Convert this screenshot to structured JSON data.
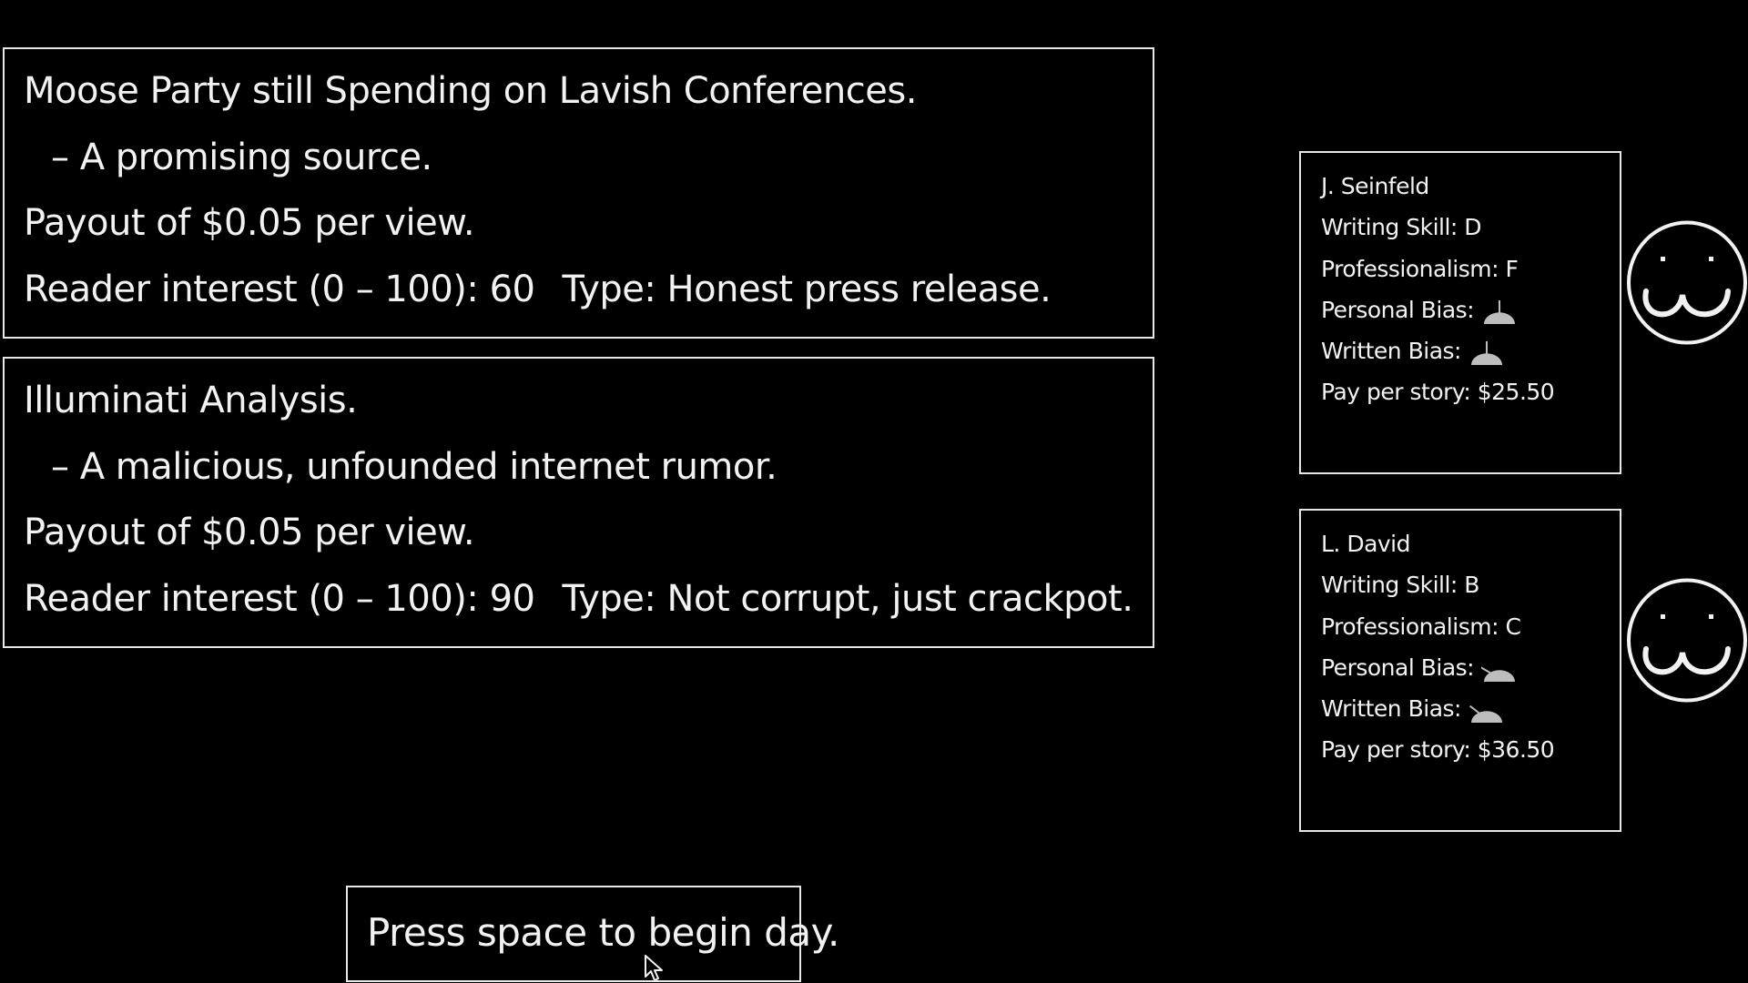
{
  "stories": [
    {
      "headline": "Moose Party still Spending on Lavish Conferences.",
      "source": "– A promising source.",
      "payout": "Payout of $0.05 per view.",
      "interest": "Reader interest (0 – 100): 60",
      "type": "Type: Honest press release."
    },
    {
      "headline": "Illuminati Analysis.",
      "source": "– A malicious, unfounded internet rumor.",
      "payout": "Payout of $0.05 per view.",
      "interest": "Reader interest (0 – 100): 90",
      "type": "Type: Not corrupt, just crackpot."
    }
  ],
  "reporters": [
    {
      "name": "J. Seinfeld",
      "writing_skill": "Writing Skill: D",
      "professionalism": "Professionalism: F",
      "personal_bias_label": "Personal Bias:",
      "personal_bias_lean": 0.0,
      "written_bias_label": "Written Bias:",
      "written_bias_lean": 0.0,
      "pay": "Pay per story: $25.50"
    },
    {
      "name": "L. David",
      "writing_skill": "Writing Skill: B",
      "professionalism": "Professionalism: C",
      "personal_bias_label": "Personal Bias:",
      "personal_bias_lean": -0.7,
      "written_bias_label": "Written Bias:",
      "written_bias_lean": -0.6,
      "pay": "Pay per story: $36.50"
    }
  ],
  "prompt": {
    "text": "Press space to begin day."
  },
  "colors": {
    "background": "#000000",
    "foreground": "#f2f2f2",
    "gauge": "#bdbdbd"
  }
}
